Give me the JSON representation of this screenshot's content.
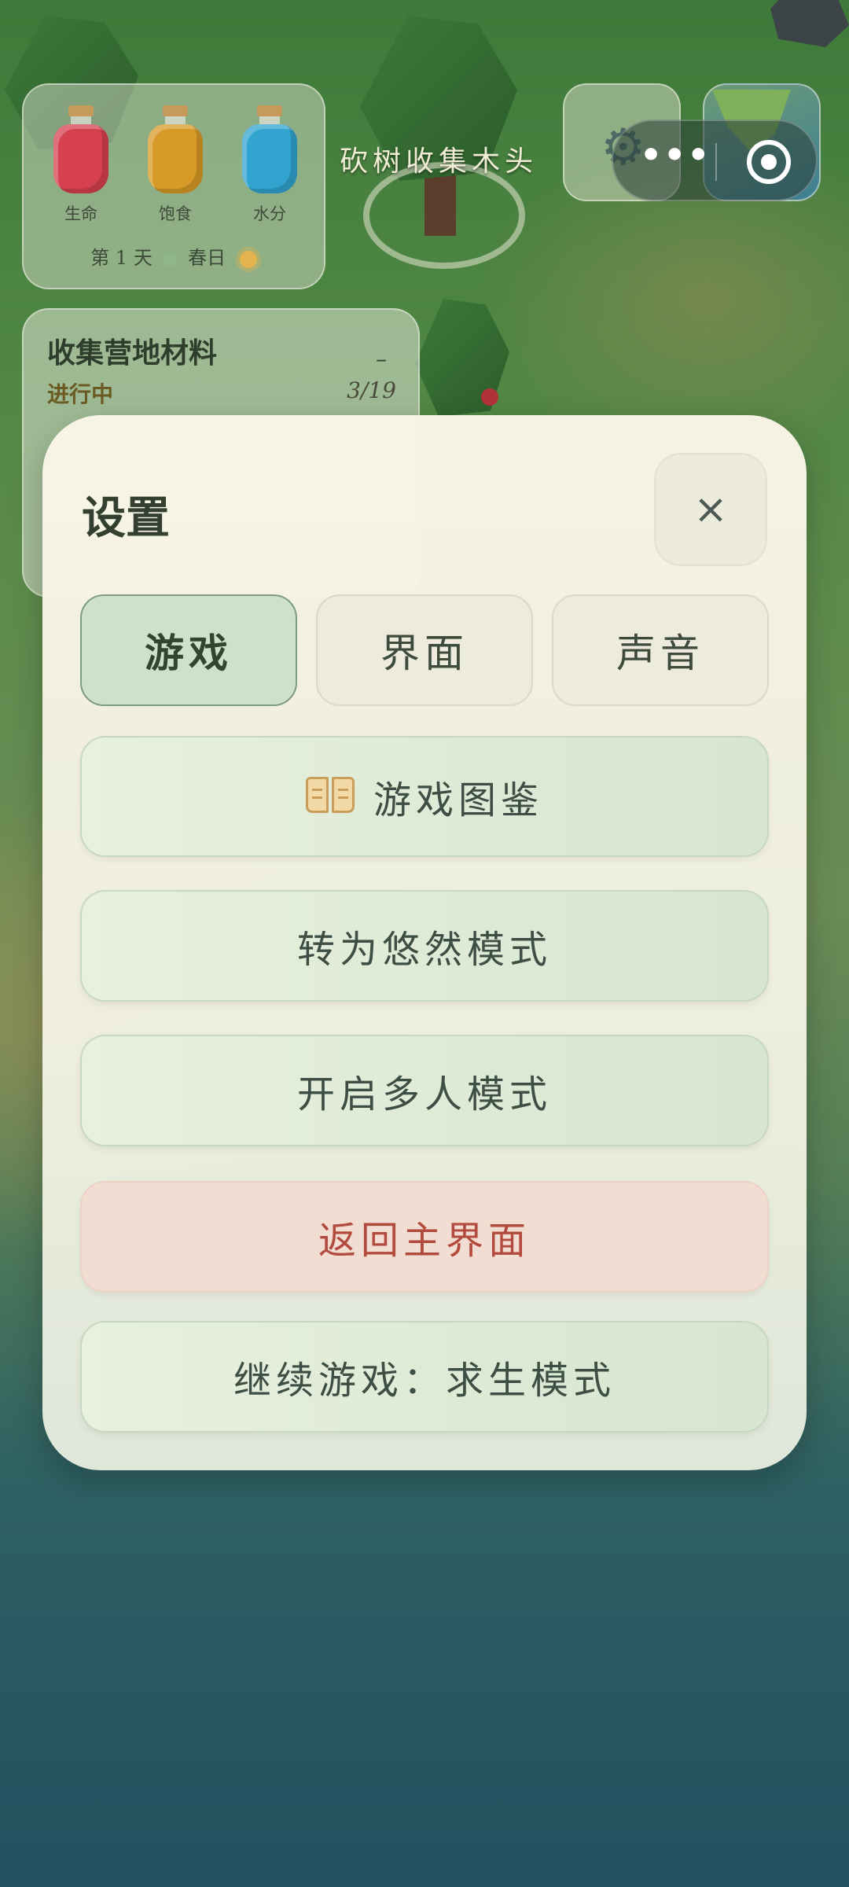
{
  "hud": {
    "bottles": [
      {
        "label": "生命",
        "color": "#d6414f"
      },
      {
        "label": "饱食",
        "color": "#d79a26"
      },
      {
        "label": "水分",
        "color": "#31a4cf"
      }
    ],
    "day_prefix": "第",
    "day_number": "1",
    "day_suffix": "天",
    "season": "春日",
    "weather_icon": "sun-icon"
  },
  "quest_hint": "砍树收集木头",
  "top_buttons": {
    "settings_icon": "gear-icon",
    "map_icon": "map-icon",
    "more_glyph": "•••",
    "capsule_icons": [
      "more-icon",
      "target-icon"
    ]
  },
  "quest_panel": {
    "title": "收集营地材料",
    "dash": "–",
    "status": "进行中",
    "progress": "3/19"
  },
  "settings": {
    "title": "设置",
    "close_glyph": "×",
    "tabs": [
      {
        "label": "游戏",
        "active": true
      },
      {
        "label": "界面",
        "active": false
      },
      {
        "label": "声音",
        "active": false
      }
    ],
    "buttons": {
      "encyclopedia": "游戏图鉴",
      "relax_mode": "转为悠然模式",
      "multiplayer": "开启多人模式",
      "main_menu": "返回主界面",
      "continue": "继续游戏：求生模式"
    }
  },
  "colors": {
    "accent_green": "#cfe1cc",
    "danger_text": "#b24b3d",
    "danger_bg": "#f2ddd2"
  }
}
